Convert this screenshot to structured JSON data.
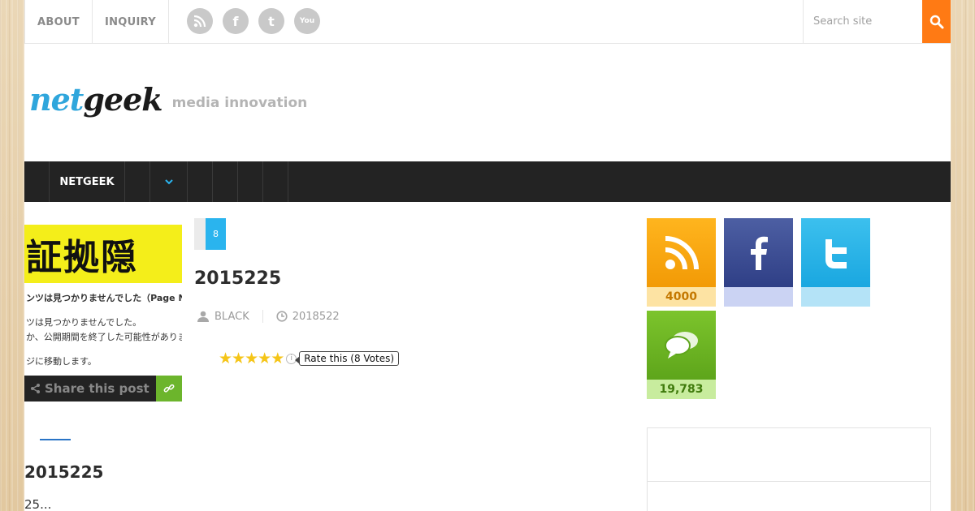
{
  "topnav": {
    "items": [
      "ABOUT",
      "INQUIRY"
    ]
  },
  "social_top": [
    {
      "name": "rss-icon",
      "glyph": ""
    },
    {
      "name": "facebook-icon",
      "glyph": "f"
    },
    {
      "name": "twitter-icon",
      "glyph": "t"
    },
    {
      "name": "youtube-icon",
      "glyph": "You"
    }
  ],
  "search": {
    "placeholder": "Search site"
  },
  "logo": {
    "net": "net",
    "geek": "geek",
    "tagline": "media innovation"
  },
  "mainnav": {
    "items": [
      "",
      "NETGEEK",
      "",
      ""
    ]
  },
  "featured": {
    "headline_kanji": "証拠隠",
    "line1": "ンツは見つかりませんでした（Page Not",
    "line2": "ツは見つかりませんでした。",
    "line3": "か、公開期間を終了した可能性があります。",
    "line4": "ジに移動します。"
  },
  "share": {
    "label": "Share this post"
  },
  "left_post": {
    "title": "2015225",
    "excerpt": "25..."
  },
  "post": {
    "category_count": "8",
    "title": "2015225",
    "author": "BLACK",
    "date": "2018522",
    "rating": {
      "stars": 5,
      "tooltip": "Rate this (8 Votes)"
    }
  },
  "counters": {
    "rss": "4000",
    "facebook": "",
    "twitter": "",
    "comments": "19,783"
  },
  "colors": {
    "accent_orange": "#ff7a14",
    "accent_blue": "#2ab4ee",
    "nav_dark": "#232323"
  }
}
